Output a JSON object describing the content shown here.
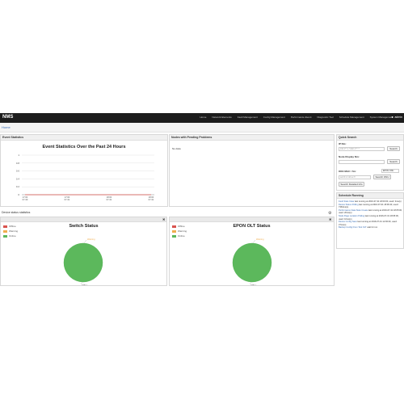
{
  "app": {
    "brand": "NMS",
    "menu": [
      "Home",
      "Network Elements",
      "Fault Management",
      "Config Management",
      "Performance Event",
      "Diagnostic Tool",
      "Schedule Management",
      "System Management"
    ],
    "user": "admin"
  },
  "breadcrumb": {
    "home": "Home"
  },
  "event_panel": {
    "header": "Event Statistics",
    "chart_title": "Event Statistics Over the Past 24 Hours"
  },
  "nodes_panel": {
    "header": "Nodes with Pending Problems",
    "empty_text": "No data"
  },
  "quick_search": {
    "header": "Quick Search",
    "ip_label": "IP Nm:",
    "ip_placeholder": "192.1**.1.*/192.1**.*.*",
    "search_label": "Search",
    "node_display_label": "Node Display Nm:",
    "onu_mac_label": "ONU MAC / Sn:",
    "onu_select": "EPON ONU",
    "onu_placeholder": "aa:bb:cc:dd:ee:ff",
    "search_onu_label": "Search ONU",
    "search_detailed_label": "Search Detailed Info"
  },
  "schedule_panel": {
    "header": "Schedule Running",
    "items": [
      {
        "link": "Fault Stats Clear",
        "text": "last running at 2016-07-31 18:00:00, used: 3ms(s)"
      },
      {
        "link": "Device Status Polling",
        "text": "last running at 2016-07-31 18:06:43, used: 7363ms(s)"
      },
      {
        "link": "Performance Data Stats Create",
        "text": "last running at 2016-07-31 18:05:00, used: 20ms(s)"
      },
      {
        "link": "Node Page Location Polling",
        "text": "last running at 2016-07-31 18:05:00, used: 10ms(s)"
      },
      {
        "link": "Device Config Save",
        "text": "last running at 2016-07-31 12:00:00, used: 37ms(s)"
      },
      {
        "link": "Backup Config From Tool OLT",
        "text": "wait for run"
      }
    ]
  },
  "device_status": {
    "title": "Device status statistics"
  },
  "legend": {
    "offline": "Offline",
    "warning": "Warning",
    "online": "Online"
  },
  "colors": {
    "offline": "#d9534f",
    "warning": "#f0ad4e",
    "online": "#5cb85c",
    "navbar": "#1c1c1c"
  },
  "chart_data": [
    {
      "type": "line",
      "title": "Event Statistics Over the Past 24 Hours",
      "x": [
        "17:00 07-30",
        "17:00 07-31",
        "18:00 07-31",
        "18:00 07-31"
      ],
      "series": [
        {
          "values": [
            0,
            0,
            0,
            0
          ]
        }
      ],
      "ylim": [
        0,
        1
      ],
      "yticks": [
        "1",
        "0.8",
        "0.6",
        "0.4",
        "0.2",
        "0"
      ],
      "grid": true
    },
    {
      "type": "pie",
      "title": "Switch Status",
      "labels": [
        "Offline",
        "Warning",
        "Online"
      ],
      "values": [
        0,
        0,
        100
      ],
      "annotations": [
        "Warning",
        "Offline"
      ]
    },
    {
      "type": "pie",
      "title": "EPON OLT Status",
      "labels": [
        "Offline",
        "Warning",
        "Online"
      ],
      "values": [
        0,
        0,
        100
      ],
      "annotations": [
        "Warning",
        "Offline"
      ]
    }
  ]
}
